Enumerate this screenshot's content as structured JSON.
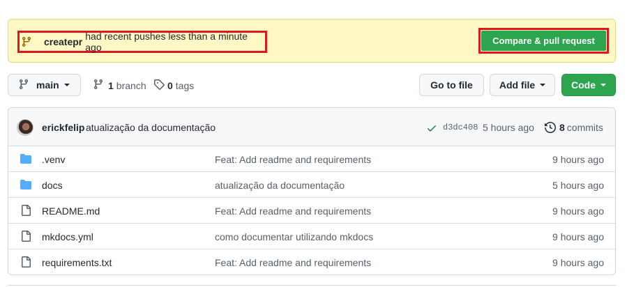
{
  "banner": {
    "branch_name": "createpr",
    "message": "had recent pushes less than a minute ago",
    "compare_label": "Compare & pull request"
  },
  "toolbar": {
    "branch_label": "main",
    "branches_count": "1",
    "branches_label": "branch",
    "tags_count": "0",
    "tags_label": "tags",
    "goto_label": "Go to file",
    "addfile_label": "Add file",
    "code_label": "Code"
  },
  "commit": {
    "author": "erickfelip",
    "message": "atualização da documentação",
    "sha": "d3dc408",
    "time": "5 hours ago",
    "count": "8",
    "count_label": "commits"
  },
  "files": [
    {
      "name": ".venv",
      "type": "folder",
      "message": "Feat: Add readme and requirements",
      "age": "9 hours ago"
    },
    {
      "name": "docs",
      "type": "folder",
      "message": "atualização da documentação",
      "age": "5 hours ago"
    },
    {
      "name": "README.md",
      "type": "file",
      "message": "Feat: Add readme and requirements",
      "age": "9 hours ago"
    },
    {
      "name": "mkdocs.yml",
      "type": "file",
      "message": "como documentar utilizando mkdocs",
      "age": "9 hours ago"
    },
    {
      "name": "requirements.txt",
      "type": "file",
      "message": "Feat: Add readme and requirements",
      "age": "9 hours ago"
    }
  ],
  "colors": {
    "banner_bg": "#fff8c5",
    "highlight": "#e0161b",
    "primary_green": "#2da44e",
    "folder_blue": "#54aeff"
  }
}
